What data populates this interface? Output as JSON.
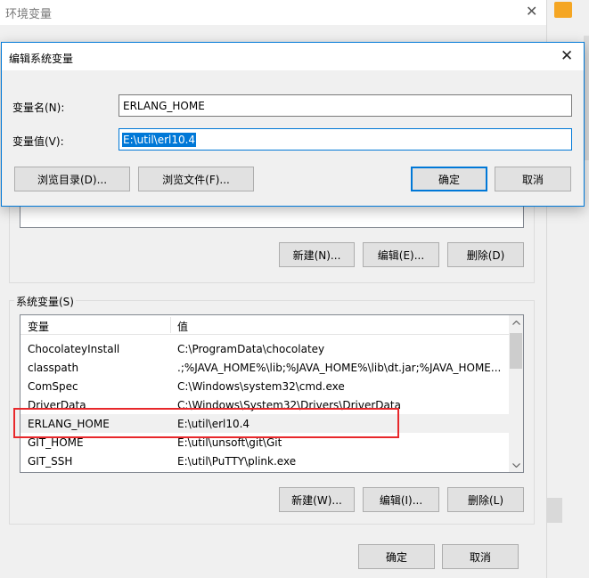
{
  "env_window": {
    "title": "环境变量",
    "close_glyph": "✕",
    "user_buttons": {
      "new": "新建(N)...",
      "edit": "编辑(E)...",
      "delete": "删除(D)"
    },
    "system_vars": {
      "label": "系统变量(S)",
      "columns": {
        "name": "变量",
        "value": "值"
      },
      "rows": [
        {
          "name": "ChocolateyInstall",
          "value": "C:\\ProgramData\\chocolatey"
        },
        {
          "name": "classpath",
          "value": ".;%JAVA_HOME%\\lib;%JAVA_HOME%\\lib\\dt.jar;%JAVA_HOME..."
        },
        {
          "name": "ComSpec",
          "value": "C:\\Windows\\system32\\cmd.exe"
        },
        {
          "name": "DriverData",
          "value": "C:\\Windows\\System32\\Drivers\\DriverData"
        },
        {
          "name": "ERLANG_HOME",
          "value": "E:\\util\\erl10.4"
        },
        {
          "name": "GIT_HOME",
          "value": "E:\\util\\unsoft\\git\\Git"
        },
        {
          "name": "GIT_SSH",
          "value": "E:\\util\\PuTTY\\plink.exe"
        }
      ],
      "buttons": {
        "new": "新建(W)...",
        "edit": "编辑(I)...",
        "delete": "删除(L)"
      }
    },
    "ok": "确定",
    "cancel": "取消"
  },
  "edit_dialog": {
    "title": "编辑系统变量",
    "close_glyph": "✕",
    "name_label": "变量名(N):",
    "name_value": "ERLANG_HOME",
    "value_label": "变量值(V):",
    "value_value": "E:\\util\\erl10.4",
    "browse_dir": "浏览目录(D)...",
    "browse_file": "浏览文件(F)...",
    "ok": "确定",
    "cancel": "取消"
  },
  "colors": {
    "accent": "#0078d7",
    "highlight": "#e8282b"
  }
}
